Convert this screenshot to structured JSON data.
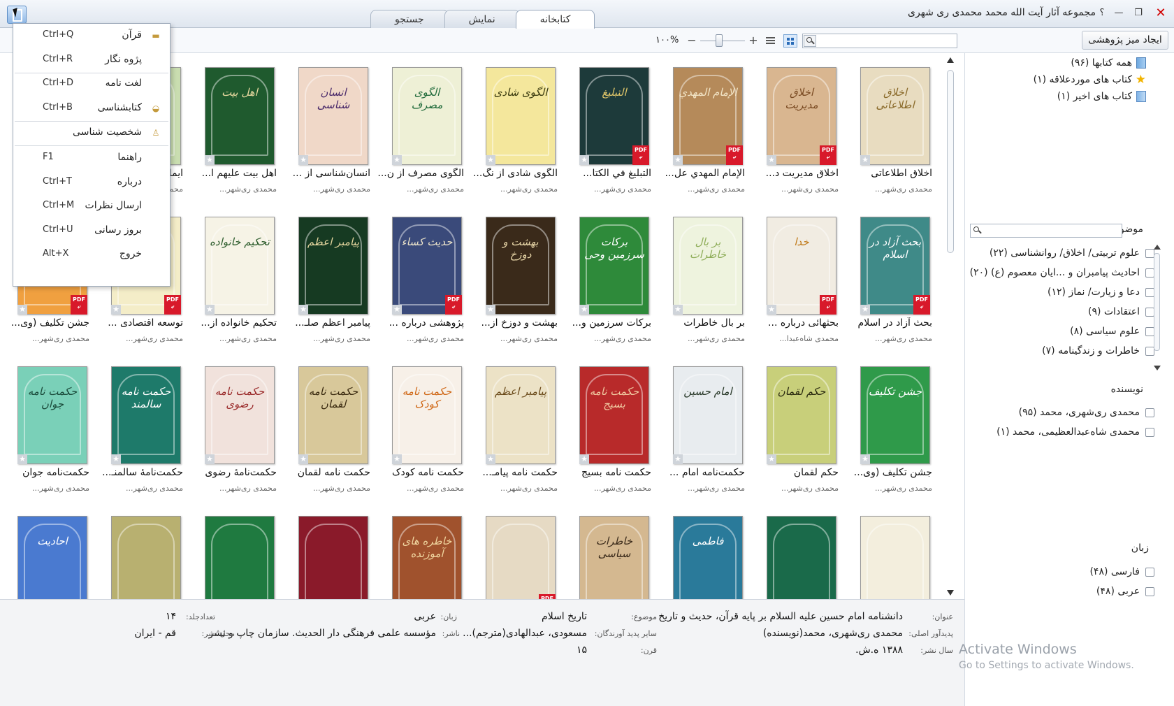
{
  "window": {
    "title": "مجموعه آثار آیت الله محمد محمدی ری شهری",
    "help": "؟",
    "minimize": "—",
    "maximize": "❐",
    "close": "✕"
  },
  "tabs": [
    {
      "label": "کتابخانه",
      "active": true
    },
    {
      "label": "نمایش",
      "active": false
    },
    {
      "label": "جستجو",
      "active": false
    }
  ],
  "toolbar": {
    "create_desk_label": "ایجاد میز پژوهشی",
    "search_placeholder": "",
    "zoom_label": "۱۰۰%",
    "zoom_plus": "+",
    "zoom_minus": "−",
    "zoom_value_percent": 40
  },
  "menu": {
    "items": [
      {
        "label": "قرآن",
        "shortcut": "Ctrl+Q",
        "icon": "quran-icon",
        "icon_glyph": "▬"
      },
      {
        "label": "پژوه نگار",
        "shortcut": "Ctrl+R",
        "icon": "",
        "icon_glyph": ""
      },
      {
        "label": "لغت نامه",
        "shortcut": "Ctrl+D",
        "icon": "",
        "icon_glyph": ""
      },
      {
        "label": "کتابشناسی",
        "shortcut": "Ctrl+B",
        "icon": "bibliography-icon",
        "icon_glyph": "◒"
      },
      {
        "label": "شخصیت شناسی",
        "shortcut": "",
        "icon": "person-icon",
        "icon_glyph": "♙"
      },
      {
        "label": "راهنما",
        "shortcut": "F1",
        "icon": "",
        "icon_glyph": ""
      },
      {
        "label": "درباره",
        "shortcut": "Ctrl+T",
        "icon": "",
        "icon_glyph": ""
      },
      {
        "label": "ارسال نظرات",
        "shortcut": "Ctrl+M",
        "icon": "",
        "icon_glyph": ""
      },
      {
        "label": "بروز رسانی",
        "shortcut": "Ctrl+U",
        "icon": "",
        "icon_glyph": ""
      },
      {
        "label": "خروج",
        "shortcut": "Alt+X",
        "icon": "",
        "icon_glyph": ""
      }
    ]
  },
  "sidebar": {
    "library": [
      {
        "label": "همه کتابها (۹۶)",
        "icon": "books-icon"
      },
      {
        "label": "کتاب های موردعلاقه (۱)",
        "icon": "star-icon"
      },
      {
        "label": "کتاب های اخیر (۱)",
        "icon": "recent-books-icon"
      }
    ],
    "subject_heading": "موضوع",
    "subjects": [
      "علوم تربیتی/ اخلاق/ روانشناسی (۲۲)",
      "احادیث پیامبران و ...ایان معصوم (ع) (۲۰)",
      "دعا و زیارت/ نماز (۱۲)",
      "اعتقادات (۹)",
      "علوم سیاسی (۸)",
      "خاطرات و زندگینامه (۷)"
    ],
    "author_heading": "نویسنده",
    "authors": [
      "محمدی ری‌شهری، محمد (۹۵)",
      "محمدی شاه‌عبدالعظیمی، محمد (۱)"
    ],
    "language_heading": "زبان",
    "languages": [
      "فارسی (۴۸)",
      "عربی (۴۸)"
    ]
  },
  "activation": {
    "line1": "Activate Windows",
    "line2": "Go to Settings to activate Windows."
  },
  "books": [
    {
      "title": "اخلاق اطلاعاتی",
      "author": "محمدی ری‌شهر...",
      "color": "#e8dcc0",
      "ink": "#8a6a2a",
      "pdf": false,
      "cover_text": "اخلاق اطلاعاتی"
    },
    {
      "title": "اخلاق مدیریت د...",
      "author": "محمدی ری‌شهر...",
      "color": "#d9b690",
      "ink": "#7a4a22",
      "pdf": true,
      "cover_text": "اخلاق مدیریت"
    },
    {
      "title": "الإمام المهدي عل...",
      "author": "محمدی ری‌شهر...",
      "color": "#b58a5a",
      "ink": "#f3e6c8",
      "pdf": true,
      "cover_text": "الإمام المهدي"
    },
    {
      "title": "التبليغ في الكتا...",
      "author": "محمدی ری‌شهر...",
      "color": "#1d3a3a",
      "ink": "#e0c66a",
      "pdf": true,
      "cover_text": "التبليغ"
    },
    {
      "title": "الگوی شادی از نگ...",
      "author": "محمدی ری‌شهر...",
      "color": "#f4e79c",
      "ink": "#3b3b10",
      "pdf": false,
      "cover_text": "الگوی شادی"
    },
    {
      "title": "الگوی مصرف از ن...",
      "author": "محمدی ری‌شهر...",
      "color": "#eef0d6",
      "ink": "#1f6a3a",
      "pdf": false,
      "cover_text": "الگوی مصرف"
    },
    {
      "title": "انسان‌شناسی از ...",
      "author": "محمدی ری‌شهر...",
      "color": "#f0d8c8",
      "ink": "#4a2a6a",
      "pdf": false,
      "cover_text": "انسان شناسی"
    },
    {
      "title": "اهل بیت علیهم ا...",
      "author": "محمدی ری‌شهر...",
      "color": "#1f5a2e",
      "ink": "#e8d9a0",
      "pdf": false,
      "cover_text": "اهل بیت"
    },
    {
      "title": "ایما...",
      "author": "محمدی ری‌شهر...",
      "color": "#c9ddb0",
      "ink": "#2a4a1a",
      "pdf": false,
      "cover_text": ""
    },
    {
      "title": "",
      "author": "",
      "color": "#ffffff",
      "ink": "#ffffff",
      "pdf": false,
      "cover_text": ""
    },
    {
      "title": "بحث آزاد در اسلام",
      "author": "محمدی ری‌شهر...",
      "color": "#3f8a88",
      "ink": "#ffffff",
      "pdf": true,
      "cover_text": "بحث آزاد در اسلام"
    },
    {
      "title": "بحثهائی درباره ...",
      "author": "محمدی شاه‌عبدا...",
      "color": "#f1ece2",
      "ink": "#c07a1a",
      "pdf": true,
      "cover_text": "خدا"
    },
    {
      "title": "بر بال خاطرات",
      "author": "محمدی ری‌شهر...",
      "color": "#eef3de",
      "ink": "#8fae5a",
      "pdf": false,
      "cover_text": "بر بال خاطرات"
    },
    {
      "title": "برکات سرزمین و...",
      "author": "محمدی ری‌شهر...",
      "color": "#2e8a3a",
      "ink": "#ffffff",
      "pdf": false,
      "cover_text": "برکات سرزمین وحی"
    },
    {
      "title": "بهشت و دوزخ از...",
      "author": "محمدی ری‌شهر...",
      "color": "#3a2a1a",
      "ink": "#e8d6a8",
      "pdf": false,
      "cover_text": "بهشت و دوزخ"
    },
    {
      "title": "پژوهشی درباره ...",
      "author": "محمدی ری‌شهر...",
      "color": "#3a4a7a",
      "ink": "#e8e0c8",
      "pdf": true,
      "cover_text": "حدیث کساء"
    },
    {
      "title": "پیامبر اعظم صلـ...",
      "author": "محمدی ری‌شهر...",
      "color": "#163a22",
      "ink": "#e6d7a0",
      "pdf": false,
      "cover_text": "پیامبر اعظم"
    },
    {
      "title": "تحکیم خانواده از...",
      "author": "محمدی ری‌شهر...",
      "color": "#f6f3e6",
      "ink": "#2a5a2a",
      "pdf": false,
      "cover_text": "تحکیم خانواده"
    },
    {
      "title": "توسعه اقتصادی ...",
      "author": "محمدی ری‌شهر...",
      "color": "#f4edc8",
      "ink": "#5a4a1a",
      "pdf": true,
      "cover_text": ""
    },
    {
      "title": "جشن تکلیف (وی...",
      "author": "محمدی ری‌شهر...",
      "color": "#f0a040",
      "ink": "#ffffff",
      "pdf": true,
      "cover_text": ""
    },
    {
      "title": "جشن تکلیف (وی...",
      "author": "محمدی ری‌شهر...",
      "color": "#2f9a4a",
      "ink": "#ffffff",
      "pdf": false,
      "cover_text": "جشن تکلیف"
    },
    {
      "title": "حکم لقمان",
      "author": "محمدی ری‌شهر...",
      "color": "#c8cf7a",
      "ink": "#2a2a10",
      "pdf": false,
      "cover_text": "حکم لقمان"
    },
    {
      "title": "حکمت‌نامه امام ...",
      "author": "محمدی ری‌شهر...",
      "color": "#e8ecef",
      "ink": "#2a3a2a",
      "pdf": false,
      "cover_text": "امام حسین"
    },
    {
      "title": "حکمت نامه بسیج",
      "author": "محمدی ری‌شهر...",
      "color": "#b82a2a",
      "ink": "#f0c8a0",
      "pdf": false,
      "cover_text": "حکمت نامه بسیج"
    },
    {
      "title": "حکمت نامه پیامـ...",
      "author": "محمدی ری‌شهر...",
      "color": "#ece2c6",
      "ink": "#6a4a1a",
      "pdf": false,
      "cover_text": "پیامبر اعظم"
    },
    {
      "title": "حکمت نامه کودک",
      "author": "محمدی ری‌شهر...",
      "color": "#f7f0e8",
      "ink": "#d06a1a",
      "pdf": false,
      "cover_text": "حکمت نامه کودک"
    },
    {
      "title": "حکمت نامه لقمان",
      "author": "محمدی ری‌شهر...",
      "color": "#d8c89a",
      "ink": "#3a2a10",
      "pdf": false,
      "cover_text": "حکمت نامه لقمان"
    },
    {
      "title": "حکمت‌نامهٔ رضوی",
      "author": "محمدی ری‌شهر...",
      "color": "#f1e2dc",
      "ink": "#9a2a2a",
      "pdf": false,
      "cover_text": "حکمت نامه رضوی"
    },
    {
      "title": "حکمت‌نامهٔ سالمنـ...",
      "author": "محمدی ری‌شهر...",
      "color": "#1e7a6a",
      "ink": "#ffffff",
      "pdf": false,
      "cover_text": "حکمت نامه سالمند"
    },
    {
      "title": "حکمت‌نامه جوان",
      "author": "محمدی ری‌شهر...",
      "color": "#7ad0b8",
      "ink": "#1a4a3a",
      "pdf": false,
      "cover_text": "حکمت نامه جوان"
    },
    {
      "title": "",
      "author": "",
      "color": "#f3eedd",
      "ink": "#7a1a1a",
      "pdf": false,
      "cover_text": ""
    },
    {
      "title": "",
      "author": "",
      "color": "#1a6a4a",
      "ink": "#e8d6a0",
      "pdf": false,
      "cover_text": ""
    },
    {
      "title": "",
      "author": "",
      "color": "#2a7a9a",
      "ink": "#ffffff",
      "pdf": false,
      "cover_text": "فاطمی"
    },
    {
      "title": "",
      "author": "",
      "color": "#d4b890",
      "ink": "#3a2a1a",
      "pdf": false,
      "cover_text": "خاطرات سیاسی"
    },
    {
      "title": "",
      "author": "",
      "color": "#e6dac4",
      "ink": "#2a2a2a",
      "pdf": true,
      "cover_text": ""
    },
    {
      "title": "",
      "author": "",
      "color": "#a0522d",
      "ink": "#f0d6a0",
      "pdf": false,
      "cover_text": "خاطره های آموزنده"
    },
    {
      "title": "",
      "author": "",
      "color": "#8a1a2a",
      "ink": "#e6c68a",
      "pdf": false,
      "cover_text": ""
    },
    {
      "title": "",
      "author": "",
      "color": "#1f7a40",
      "ink": "#e6d6a0",
      "pdf": false,
      "cover_text": ""
    },
    {
      "title": "",
      "author": "",
      "color": "#b8b070",
      "ink": "#3a3a1a",
      "pdf": false,
      "cover_text": ""
    },
    {
      "title": "",
      "author": "",
      "color": "#4a7ad0",
      "ink": "#ffffff",
      "pdf": false,
      "cover_text": "احادیث"
    }
  ],
  "details": {
    "title_label": "عنوان:",
    "title_value": "دانشنامه امام حسین علیه السلام بر پایه قرآن، حدیث و تاریخ",
    "subject_label": "موضوع:",
    "subject_value": "تاریخ اسلام",
    "lang_label": "زبان:",
    "lang_value": "عربی",
    "volumes_label": "تعدادجلد:",
    "volumes_value": "۱۴",
    "author_label": "پدیدآور اصلی:",
    "author_value": "محمدی ری‌شهری، محمد(نویسنده)",
    "other_label": "سایر پدید آورندگان:",
    "other_value": "مسعودی، عبدالهادی(مترجم)...",
    "publisher_label": "ناشر:",
    "publisher_value": "مؤسسه علمی فرهنگی دار الحدیث. سازمان چاپ و نشر",
    "place_label": "محل نشر:",
    "place_value": "قم - ایران",
    "year_label": "سال نشر:",
    "year_value": "۱۳۸۸ ه.ش.",
    "century_label": "قرن:",
    "century_value": "۱۵"
  }
}
